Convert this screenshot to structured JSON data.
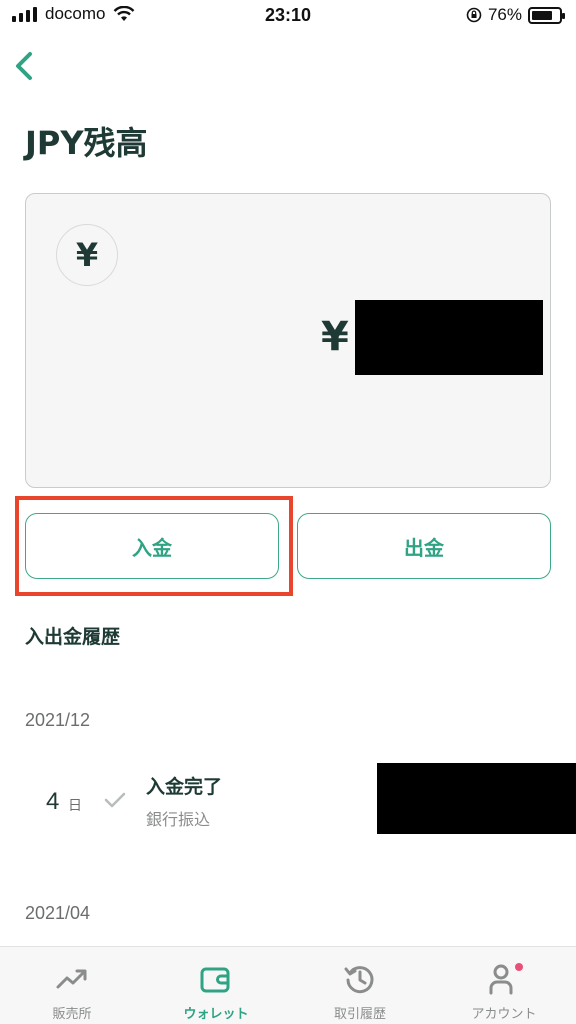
{
  "status_bar": {
    "carrier": "docomo",
    "time": "23:10",
    "battery_percent": "76%",
    "battery_level": 0.76
  },
  "page": {
    "title": "JPY残高"
  },
  "balance_card": {
    "currency_symbol": "¥",
    "amount_symbol": "¥"
  },
  "actions": {
    "deposit_label": "入金",
    "withdraw_label": "出金"
  },
  "history": {
    "section_title": "入出金履歴",
    "months": [
      "2021/12",
      "2021/04"
    ],
    "items": [
      {
        "day": "4",
        "day_unit": "日",
        "title": "入金完了",
        "subtitle": "銀行振込"
      }
    ]
  },
  "tab_bar": {
    "items": [
      {
        "label": "販売所",
        "icon": "trending-up-icon"
      },
      {
        "label": "ウォレット",
        "icon": "wallet-icon",
        "active": true
      },
      {
        "label": "取引履歴",
        "icon": "history-icon"
      },
      {
        "label": "アカウント",
        "icon": "account-icon"
      }
    ]
  },
  "colors": {
    "accent": "#2fa384",
    "text_dark": "#1f3a34",
    "highlight_box": "#e8452c",
    "notification_dot": "#e85077"
  }
}
